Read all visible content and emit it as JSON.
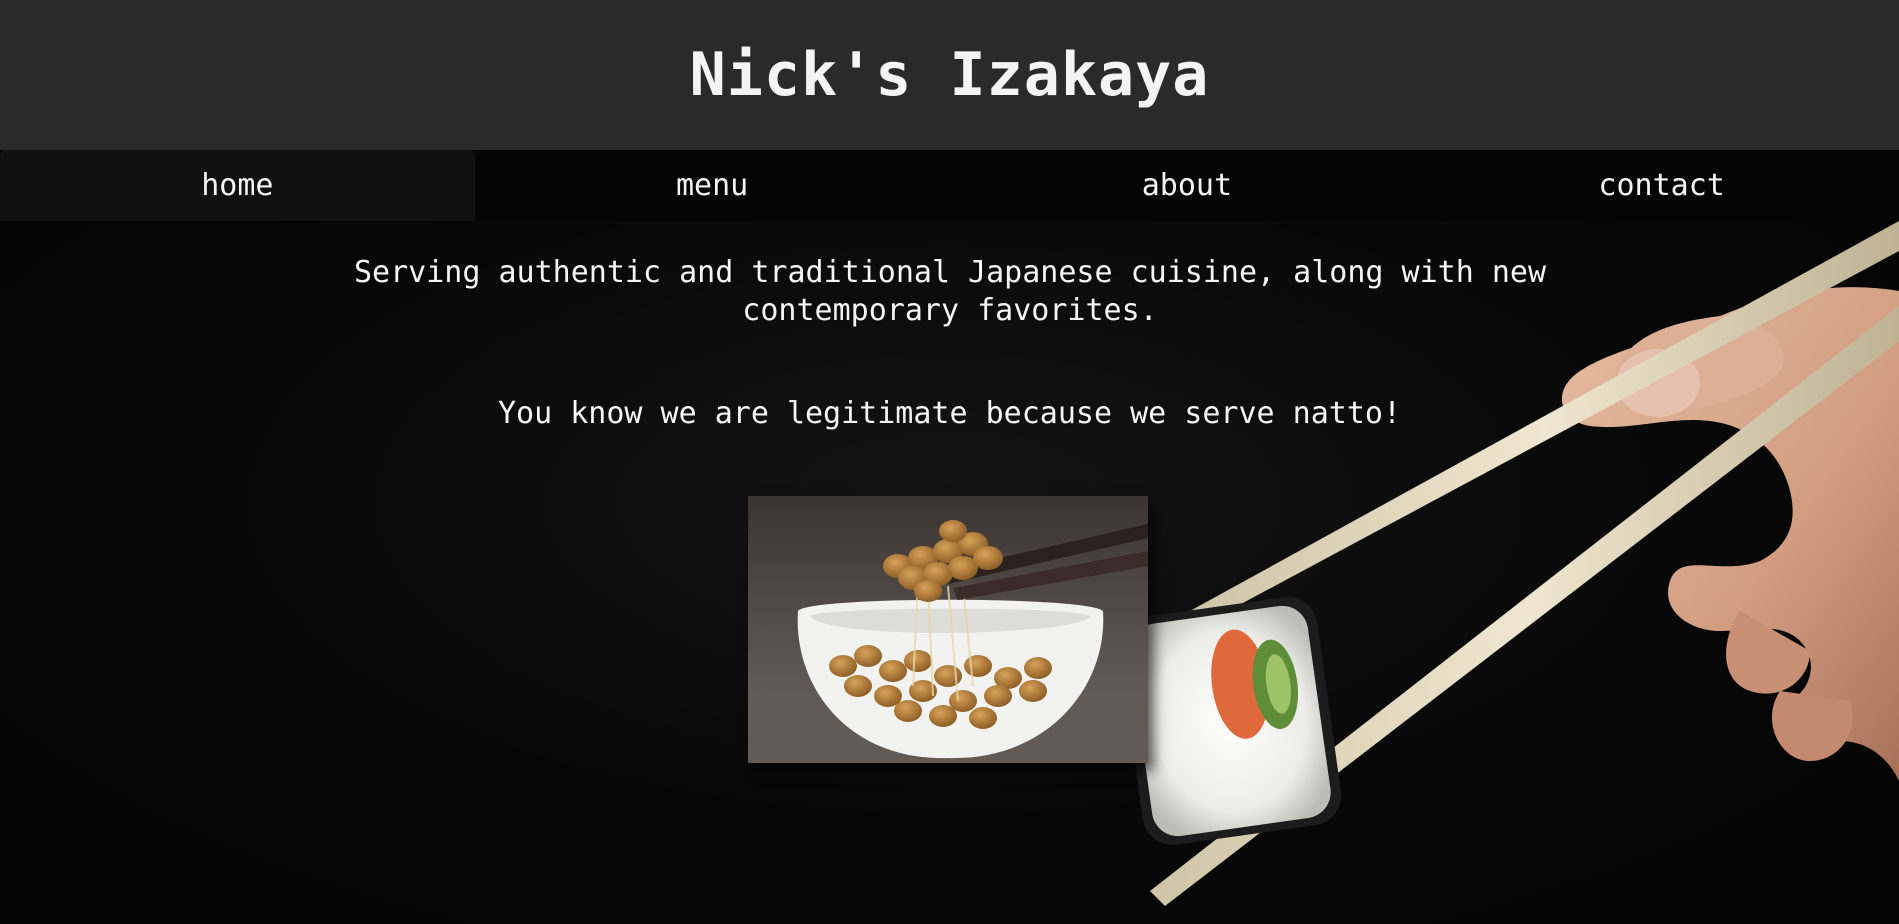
{
  "header": {
    "title": "Nick's Izakaya"
  },
  "nav": {
    "items": [
      {
        "label": "home",
        "active": true
      },
      {
        "label": "menu",
        "active": false
      },
      {
        "label": "about",
        "active": false
      },
      {
        "label": "contact",
        "active": false
      }
    ]
  },
  "main": {
    "intro": "Serving authentic and traditional Japanese cuisine, along with new contemporary favorites.",
    "natto_line": "You know we are legitimate because we serve natto!"
  },
  "colors": {
    "header_bg": "#2a2a2a",
    "active_tab_bg": "#111111",
    "page_bg": "#050505",
    "text": "#f4f4f4"
  }
}
